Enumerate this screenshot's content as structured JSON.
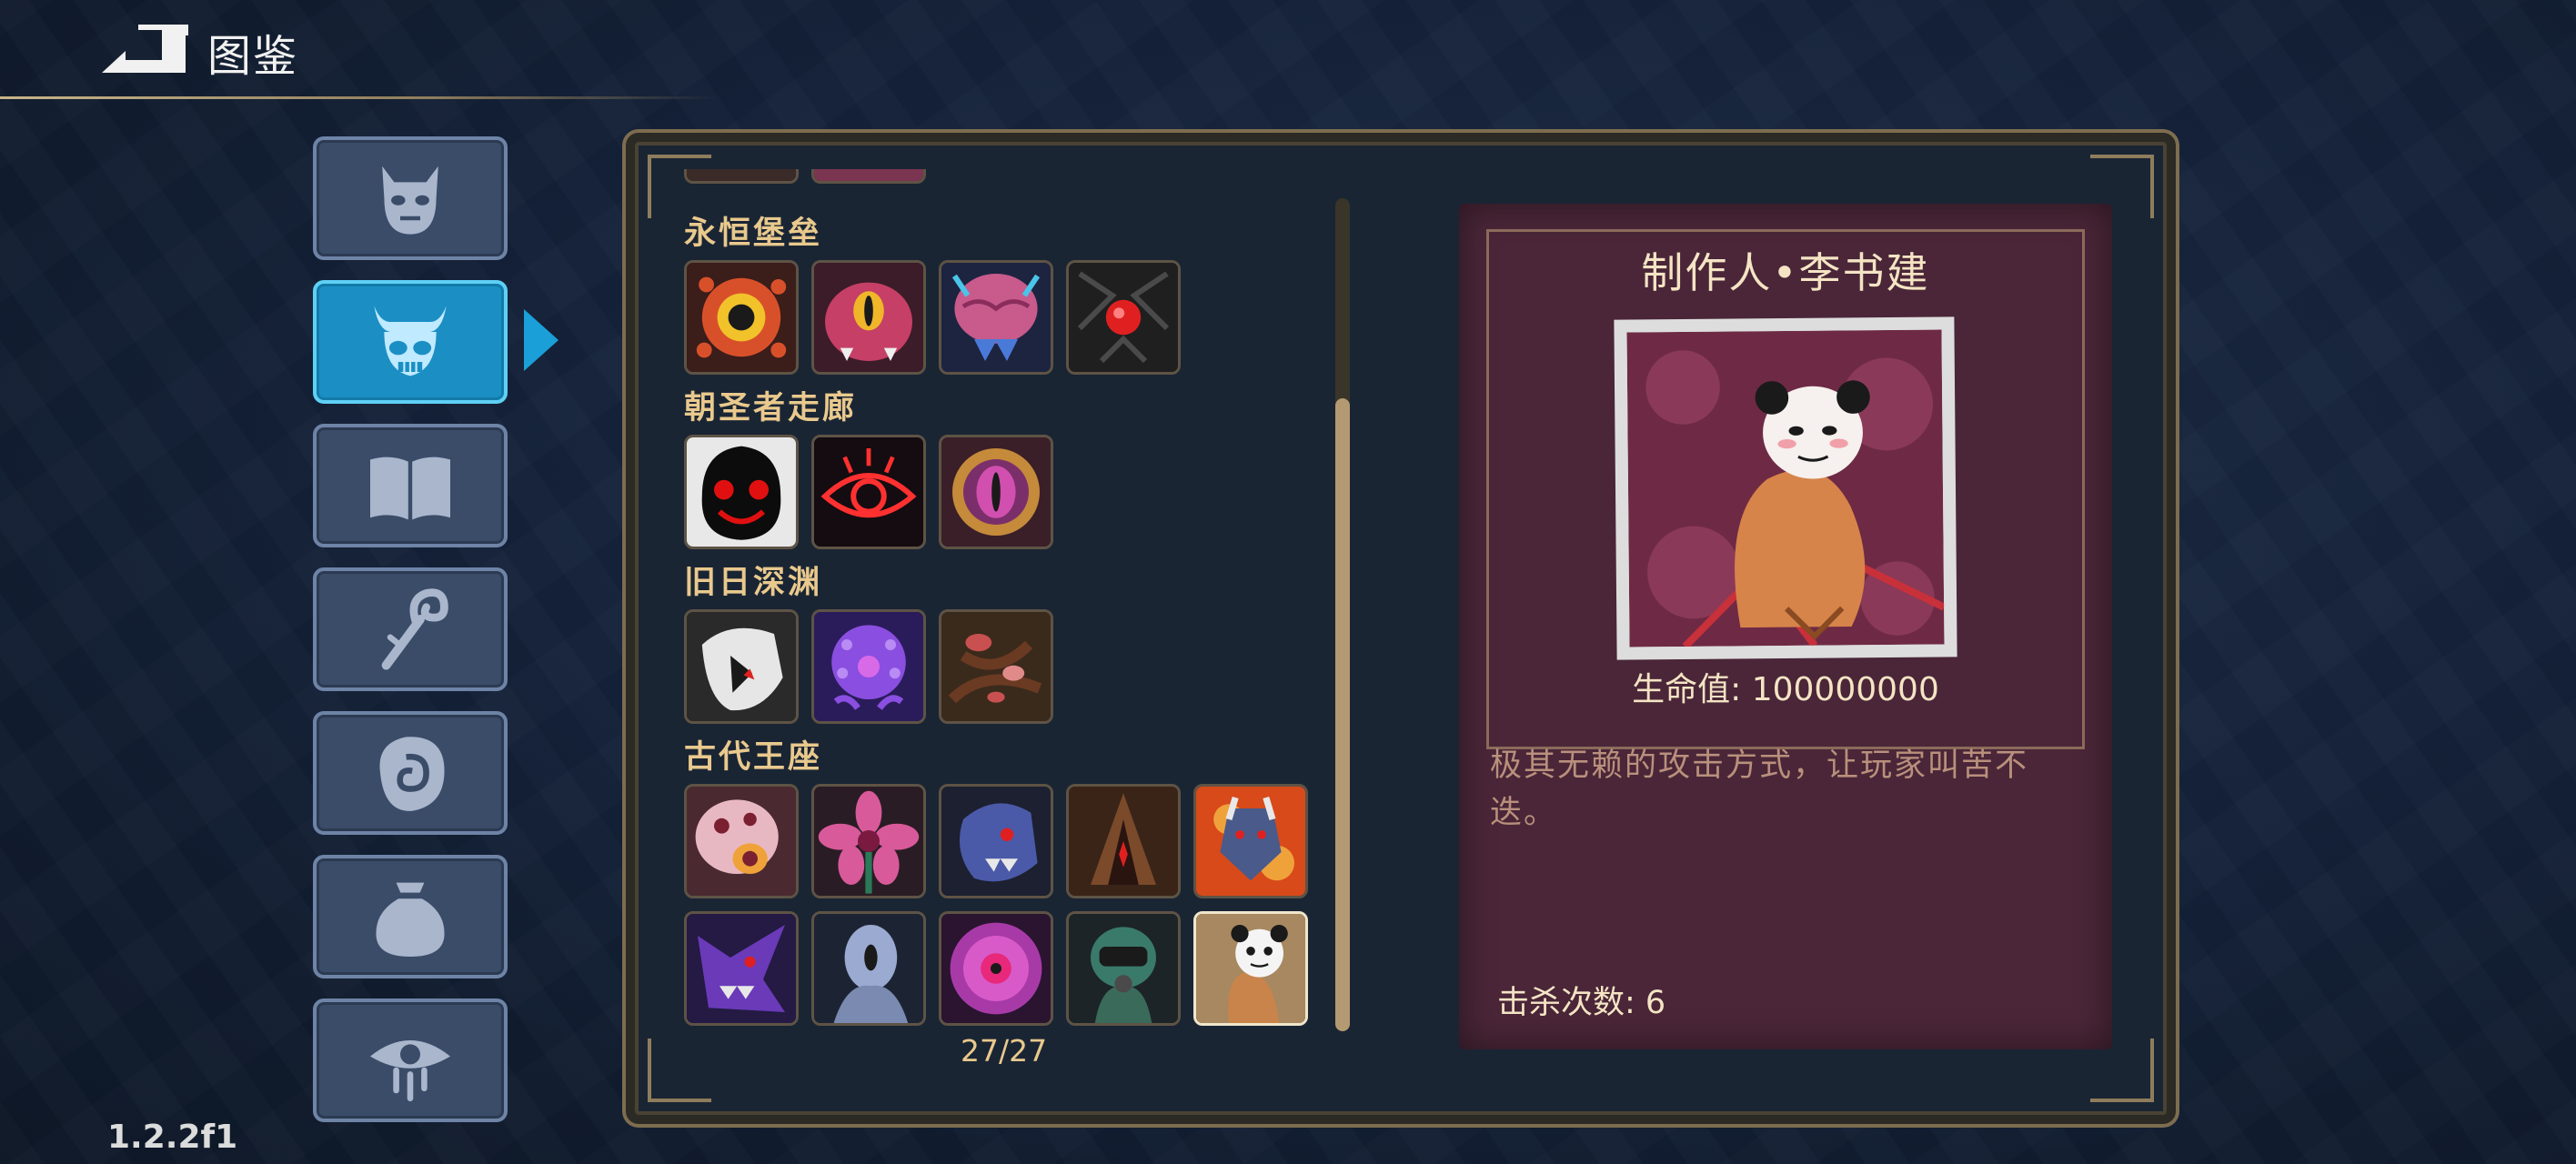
{
  "header": {
    "title": "图鉴"
  },
  "version": "1.2.2f1",
  "sidebar": {
    "items": [
      {
        "name": "demon-mask-icon",
        "active": false
      },
      {
        "name": "horned-skull-icon",
        "active": true
      },
      {
        "name": "book-icon",
        "active": false
      },
      {
        "name": "staff-icon",
        "active": false
      },
      {
        "name": "spiral-stone-icon",
        "active": false
      },
      {
        "name": "pouch-icon",
        "active": false
      },
      {
        "name": "weeping-eye-icon",
        "active": false
      }
    ]
  },
  "bestiary": {
    "sections": [
      {
        "title": "永恒堡垒",
        "monsters": [
          "sun-eye-monster",
          "pink-cyclops-monster",
          "brain-monster",
          "red-eye-cube-monster"
        ]
      },
      {
        "title": "朝圣者走廊",
        "monsters": [
          "shadow-smile-monster",
          "red-eye-sigil-monster",
          "golden-eye-monster"
        ]
      },
      {
        "title": "旧日深渊",
        "monsters": [
          "white-hood-monster",
          "purple-tentacle-monster",
          "mushroom-root-monster"
        ]
      },
      {
        "title": "古代王座",
        "monsters": [
          "flesh-skull-monster",
          "pink-flower-monster",
          "blue-beast-monster",
          "crimson-blade-monster",
          "fire-wolf-monster",
          "purple-dragon-monster",
          "pale-ghost-monster",
          "violet-blossom-monster",
          "diver-soldier-monster",
          "panda-meme-monster"
        ]
      }
    ],
    "page_count": "27/27"
  },
  "detail": {
    "name": "制作人•李书建",
    "hp_label": "生命值: 100000000",
    "description": "极其无赖的攻击方式，让玩家叫苦不迭。",
    "kills_label": "击杀次数: 6"
  }
}
